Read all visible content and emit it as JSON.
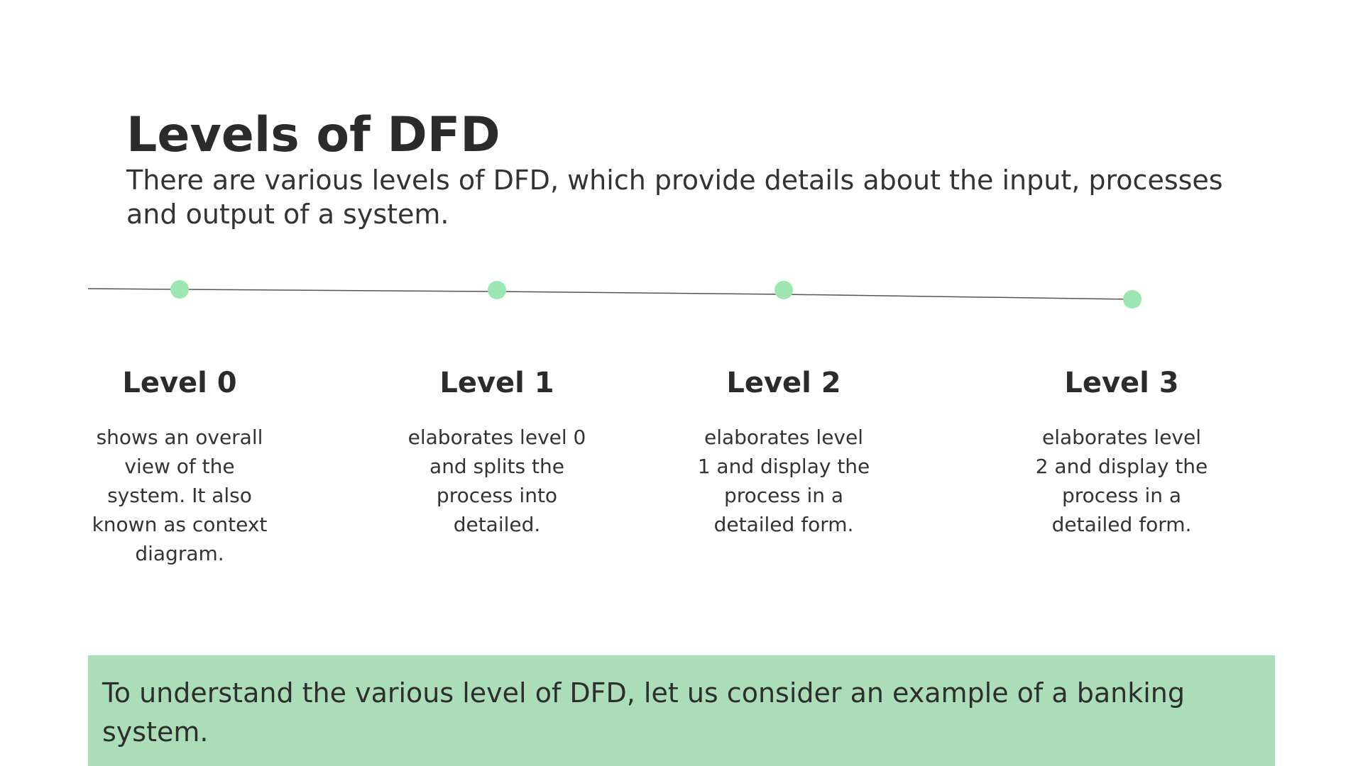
{
  "slide": {
    "title": "Levels of DFD",
    "intro": " There are various levels of DFD, which provide details about the input, processes and output of a system."
  },
  "timeline": {
    "line_color": "#555555",
    "node_color": "#9ee6b1"
  },
  "levels": [
    {
      "title": "Level 0",
      "description": "shows an overall view of the system. It also known as context diagram."
    },
    {
      "title": "Level 1",
      "description": "elaborates level 0 and splits the process into detailed."
    },
    {
      "title": "Level 2",
      "description": "elaborates level 1 and display the process in a detailed form."
    },
    {
      "title": "Level 3",
      "description": "elaborates level 2 and display the process in a detailed form."
    }
  ],
  "callout": {
    "text": "To understand the various level of DFD, let us consider an example of a banking system.",
    "background": "#abdeb8"
  }
}
